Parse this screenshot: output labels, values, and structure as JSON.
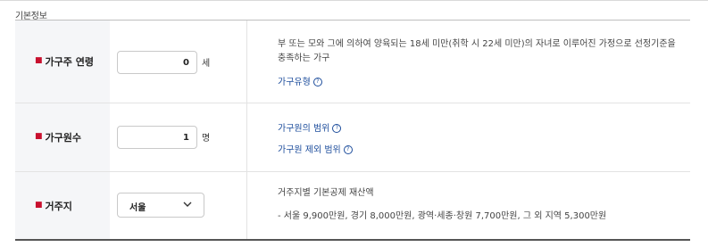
{
  "section": {
    "title": "기본정보"
  },
  "rows": {
    "age": {
      "label": "가구주 연령",
      "value": "0",
      "unit": "세",
      "description": "부 또는 모와 그에 의하여 양육되는 18세 미만(취학 시 22세 미만)의 자녀로 이루어진 가정으로 선정기준을 충족하는 가구",
      "link": "가구유형"
    },
    "members": {
      "label": "가구원수",
      "value": "1",
      "unit": "명",
      "link1": "가구원의 범위",
      "link2": "가구원 제외 범위"
    },
    "residence": {
      "label": "거주지",
      "selected": "서울",
      "desc_title": "거주지별 기본공제 재산액",
      "desc_detail": "- 서울 9,900만원, 경기 8,000만원, 광역·세종·창원 7,700만원, 그 외 지역 5,300만원"
    }
  },
  "icons": {
    "required": "required-marker-icon",
    "help": "question-circle-icon",
    "dropdown": "chevron-down-icon"
  },
  "colors": {
    "required": "#c8102e",
    "link": "#1d4d9c",
    "header_bg": "#f5f6f8"
  }
}
